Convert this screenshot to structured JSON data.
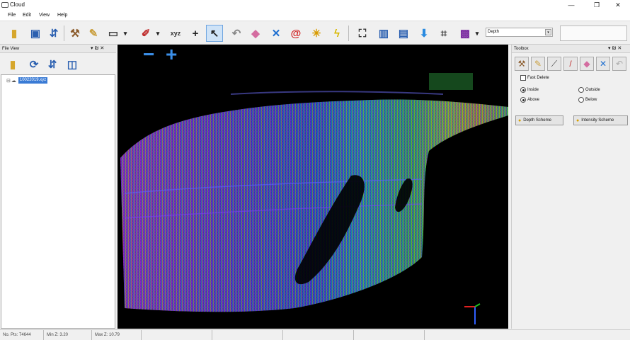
{
  "window": {
    "title": "Cloud",
    "minimize": "—",
    "maximize": "❐",
    "close": "✕"
  },
  "menu": [
    "File",
    "Edit",
    "View",
    "Help"
  ],
  "toolbar": {
    "depth_select": "Depth"
  },
  "file_view": {
    "title": "File View",
    "pin": "▾ ₪ ✕",
    "tree_item": "10022019.xyz"
  },
  "viewport": {
    "zoom_out": "−",
    "zoom_in": "+"
  },
  "toolbox": {
    "title": "Toolbox",
    "pin": "▾ ₪ ✕",
    "fast_delete": "Fast Delete",
    "inside": "Inside",
    "outside": "Outside",
    "above": "Above",
    "below": "Below",
    "depth_scheme": "Depth Scheme",
    "intensity_scheme": "Intensity Scheme"
  },
  "status": {
    "no_pts": "No. Pts: 74644",
    "min_z": "Min Z: 3.20",
    "max_z": "Max Z: 10.79"
  },
  "colors": {
    "accent": "#3a7bd5",
    "zoom": "#3b8fe8"
  }
}
